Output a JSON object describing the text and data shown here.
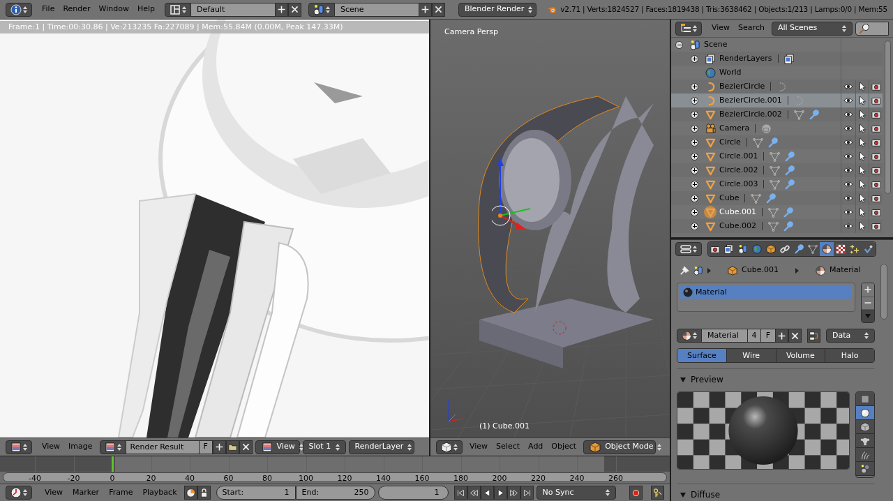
{
  "top_bar": {
    "menus": [
      "File",
      "Render",
      "Window",
      "Help"
    ],
    "layout": "Default",
    "scene": "Scene",
    "engine": "Blender Render",
    "stats": "v2.71 | Verts:1824527 | Faces:1819438 | Tris:3638462 | Objects:1/213 | Lamps:0/0 | Mem:55"
  },
  "image_editor": {
    "render_info": "Frame:1 | Time:00:30.86 | Ve:213235 Fa:227089 | Mem:55.84M (0.00M, Peak 147.33M)",
    "menus": [
      "View",
      "Image"
    ],
    "image": "Render Result",
    "fake_user": "F",
    "view": "View",
    "slot": "Slot 1",
    "layer": "RenderLayer"
  },
  "viewport": {
    "view_name": "Camera Persp",
    "object_label": "(1) Cube.001",
    "menus": [
      "View",
      "Select",
      "Add",
      "Object"
    ],
    "mode": "Object Mode"
  },
  "outliner": {
    "menus": [
      "View",
      "Search"
    ],
    "display_mode": "All Scenes",
    "tree": [
      {
        "name": "Scene",
        "kind": "scene",
        "expanded": true,
        "selected": false,
        "active": false,
        "children": [
          {
            "name": "RenderLayers",
            "kind": "renderlayers",
            "expanded": false,
            "selected": false,
            "active": false
          },
          {
            "name": "World",
            "kind": "world",
            "selected": false,
            "active": false
          },
          {
            "name": "BezierCircle",
            "kind": "curve",
            "expanded": false,
            "selected": false,
            "active": false,
            "modifier": false
          },
          {
            "name": "BezierCircle.001",
            "kind": "curve",
            "expanded": false,
            "selected": true,
            "active": false,
            "modifier": false
          },
          {
            "name": "BezierCircle.002",
            "kind": "mesh",
            "expanded": false,
            "selected": false,
            "active": false,
            "modifier": true
          },
          {
            "name": "Camera",
            "kind": "camera",
            "expanded": false,
            "selected": false,
            "active": false,
            "modifier": false
          },
          {
            "name": "Circle",
            "kind": "mesh",
            "expanded": false,
            "selected": false,
            "active": false,
            "modifier": true
          },
          {
            "name": "Circle.001",
            "kind": "mesh",
            "expanded": false,
            "selected": false,
            "active": false,
            "modifier": true
          },
          {
            "name": "Circle.002",
            "kind": "mesh",
            "expanded": false,
            "selected": false,
            "active": false,
            "modifier": true
          },
          {
            "name": "Circle.003",
            "kind": "mesh",
            "expanded": false,
            "selected": false,
            "active": false,
            "modifier": true
          },
          {
            "name": "Cube",
            "kind": "mesh",
            "expanded": false,
            "selected": false,
            "active": false,
            "modifier": true
          },
          {
            "name": "Cube.001",
            "kind": "mesh",
            "expanded": false,
            "selected": false,
            "active": true,
            "modifier": true
          },
          {
            "name": "Cube.002",
            "kind": "mesh",
            "expanded": false,
            "selected": false,
            "active": false,
            "modifier": true
          }
        ]
      }
    ]
  },
  "properties": {
    "tabs": [
      {
        "kind": "render",
        "selected": false
      },
      {
        "kind": "renderlayers",
        "selected": false
      },
      {
        "kind": "scene",
        "selected": false
      },
      {
        "kind": "world",
        "selected": false
      },
      {
        "kind": "object",
        "selected": false
      },
      {
        "kind": "constraints",
        "selected": false
      },
      {
        "kind": "modifiers",
        "selected": false
      },
      {
        "kind": "data",
        "selected": false
      },
      {
        "kind": "material",
        "selected": true
      },
      {
        "kind": "texture",
        "selected": false
      },
      {
        "kind": "particles",
        "selected": false
      },
      {
        "kind": "physics",
        "selected": false
      }
    ],
    "breadcrumb": [
      {
        "kind": "object",
        "name": "Cube.001"
      },
      {
        "kind": "material",
        "name": "Material"
      }
    ],
    "slots": [
      {
        "name": "Material",
        "selected": true
      }
    ],
    "material": {
      "name": "Material",
      "users": "4",
      "fake_user": "F",
      "link": "Data"
    },
    "type_tabs": [
      {
        "label": "Surface",
        "selected": true
      },
      {
        "label": "Wire",
        "selected": false
      },
      {
        "label": "Volume",
        "selected": false
      },
      {
        "label": "Halo",
        "selected": false
      }
    ],
    "preview_panel": {
      "title": "Preview",
      "expanded": true
    },
    "preview_shapes": [
      {
        "kind": "flat",
        "selected": false
      },
      {
        "kind": "sphere",
        "selected": true
      },
      {
        "kind": "cube",
        "selected": false
      },
      {
        "kind": "monkey",
        "selected": false
      },
      {
        "kind": "hair",
        "selected": false
      },
      {
        "kind": "sky",
        "selected": false
      }
    ],
    "diffuse_panel": {
      "title": "Diffuse",
      "expanded": true
    }
  },
  "timeline": {
    "ticks": [
      {
        "label": "-40",
        "current": false
      },
      {
        "label": "-20",
        "current": false
      },
      {
        "label": "0",
        "current": true
      },
      {
        "label": "20",
        "current": false
      },
      {
        "label": "40",
        "current": false
      },
      {
        "label": "60",
        "current": false
      },
      {
        "label": "80",
        "current": false
      },
      {
        "label": "100",
        "current": false
      },
      {
        "label": "120",
        "current": false
      },
      {
        "label": "140",
        "current": false
      },
      {
        "label": "160",
        "current": false
      },
      {
        "label": "180",
        "current": false
      },
      {
        "label": "200",
        "current": false
      },
      {
        "label": "220",
        "current": false
      },
      {
        "label": "240",
        "current": false
      },
      {
        "label": "260",
        "current": false
      }
    ],
    "menus": [
      "View",
      "Marker",
      "Frame",
      "Playback"
    ],
    "start_label": "Start:",
    "start": "1",
    "end_label": "End:",
    "end": "250",
    "current_frame": "1",
    "sync": "No Sync"
  }
}
